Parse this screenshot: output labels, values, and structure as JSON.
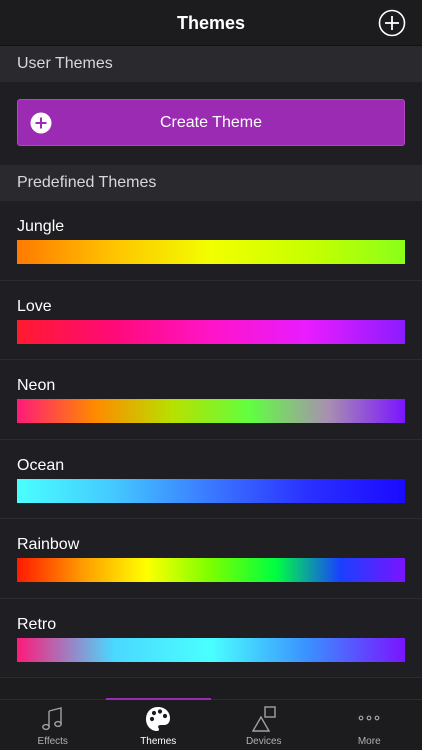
{
  "header": {
    "title": "Themes",
    "add_icon": "plus-circle-icon"
  },
  "sections": {
    "user": "User Themes",
    "predefined": "Predefined Themes"
  },
  "create_button": {
    "label": "Create Theme",
    "icon": "plus-circle-icon",
    "color": "#9b2bb2"
  },
  "themes": [
    {
      "name": "Jungle",
      "colors": [
        "#ff7a00",
        "#ffc400",
        "#f2ff00",
        "#c8ff00",
        "#8aff1a"
      ]
    },
    {
      "name": "Love",
      "colors": [
        "#ff1a2e",
        "#ff0a78",
        "#ff14c8",
        "#e81cff",
        "#8a1cff"
      ]
    },
    {
      "name": "Neon",
      "colors": [
        "#ff1a7a",
        "#ff8a00",
        "#b8e000",
        "#60ff40",
        "#a890b0",
        "#7a14ff"
      ]
    },
    {
      "name": "Ocean",
      "colors": [
        "#4affff",
        "#44c8ff",
        "#3a78ff",
        "#2a30ff",
        "#1a0aff"
      ]
    },
    {
      "name": "Rainbow",
      "colors": [
        "#ff1a00",
        "#ff9a00",
        "#ffff00",
        "#7aff00",
        "#00ff40",
        "#1a40ff",
        "#7a14ff"
      ]
    },
    {
      "name": "Retro",
      "colors": [
        "#ff1a7a",
        "#4ad8ff",
        "#4affff",
        "#3a90ff",
        "#7a14ff"
      ]
    }
  ],
  "tabs": [
    {
      "label": "Effects",
      "icon": "music-note-icon",
      "active": false
    },
    {
      "label": "Themes",
      "icon": "palette-icon",
      "active": true
    },
    {
      "label": "Devices",
      "icon": "shapes-icon",
      "active": false
    },
    {
      "label": "More",
      "icon": "more-dots-icon",
      "active": false
    }
  ],
  "colors": {
    "accent": "#9b2bb2",
    "background": "#1c1c1f",
    "row": "#1f1f23",
    "section": "#2a2a2e"
  }
}
